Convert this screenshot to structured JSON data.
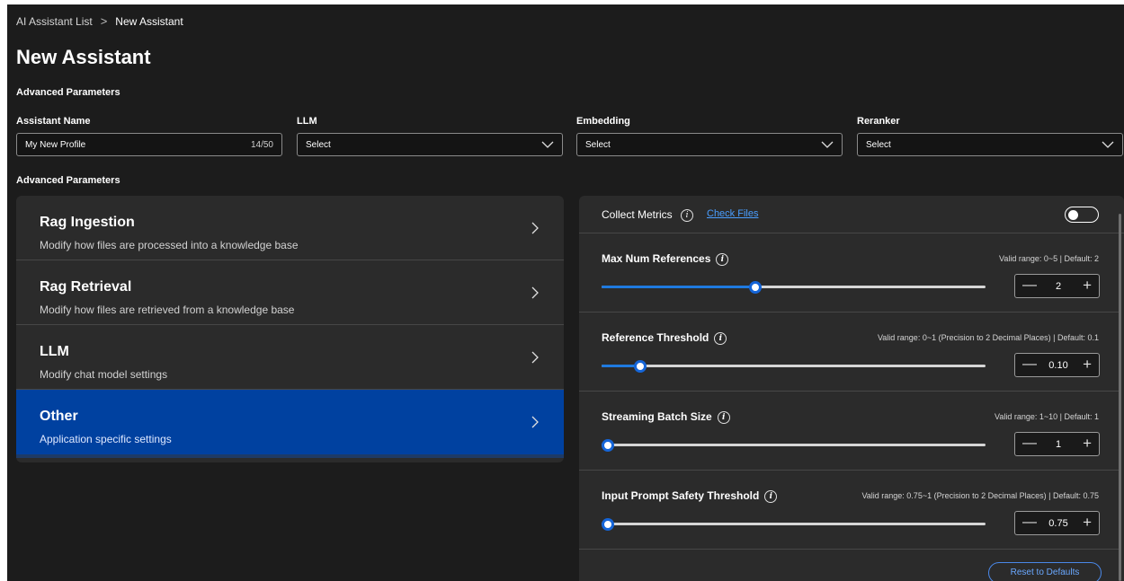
{
  "breadcrumb": {
    "parent": "AI Assistant List",
    "separator": ">",
    "current": "New Assistant"
  },
  "page": {
    "title": "New Assistant",
    "section_top": "Advanced Parameters",
    "section_mid": "Advanced Parameters"
  },
  "fields": {
    "assistant_name": {
      "label": "Assistant Name",
      "value": "My New Profile",
      "count": "14/50"
    },
    "llm": {
      "label": "LLM",
      "value": "Select"
    },
    "embedding": {
      "label": "Embedding",
      "value": "Select"
    },
    "reranker": {
      "label": "Reranker",
      "value": "Select"
    }
  },
  "nav": [
    {
      "title": "Rag Ingestion",
      "desc": "Modify how files are processed into a knowledge base"
    },
    {
      "title": "Rag Retrieval",
      "desc": "Modify how files are retrieved from a knowledge base"
    },
    {
      "title": "LLM",
      "desc": "Modify chat model settings"
    },
    {
      "title": "Other",
      "desc": "Application specific settings"
    }
  ],
  "active_nav": "Other",
  "collect_metrics": {
    "label": "Collect Metrics",
    "info": "i",
    "link": "Check Files",
    "enabled": false
  },
  "params": [
    {
      "title": "Max Num References",
      "info": "i",
      "range": "Valid range: 0~5  |  Default: 2",
      "value": "2",
      "slider_fraction": 0.4
    },
    {
      "title": "Reference Threshold",
      "info": "i",
      "range": "Valid range: 0~1 (Precision to 2 Decimal Places)  |  Default: 0.1",
      "value": "0.10",
      "slider_fraction": 0.1
    },
    {
      "title": "Streaming Batch Size",
      "info": "i",
      "range": "Valid range: 1~10  |  Default: 1",
      "value": "1",
      "slider_fraction": 0.0
    },
    {
      "title": "Input Prompt Safety Threshold",
      "info": "i",
      "range": "Valid range: 0.75~1 (Precision to 2 Decimal Places)  |  Default: 0.75",
      "value": "0.75",
      "slider_fraction": 0.0
    }
  ],
  "stepper": {
    "minus": "—",
    "plus": "+"
  },
  "reset_label": "Reset to Defaults",
  "colors": {
    "background": "#1c1c1c",
    "panel": "#2b2b2b",
    "accent": "#0041a0",
    "slider": "#1f7ae0",
    "link": "#4a9eff"
  }
}
